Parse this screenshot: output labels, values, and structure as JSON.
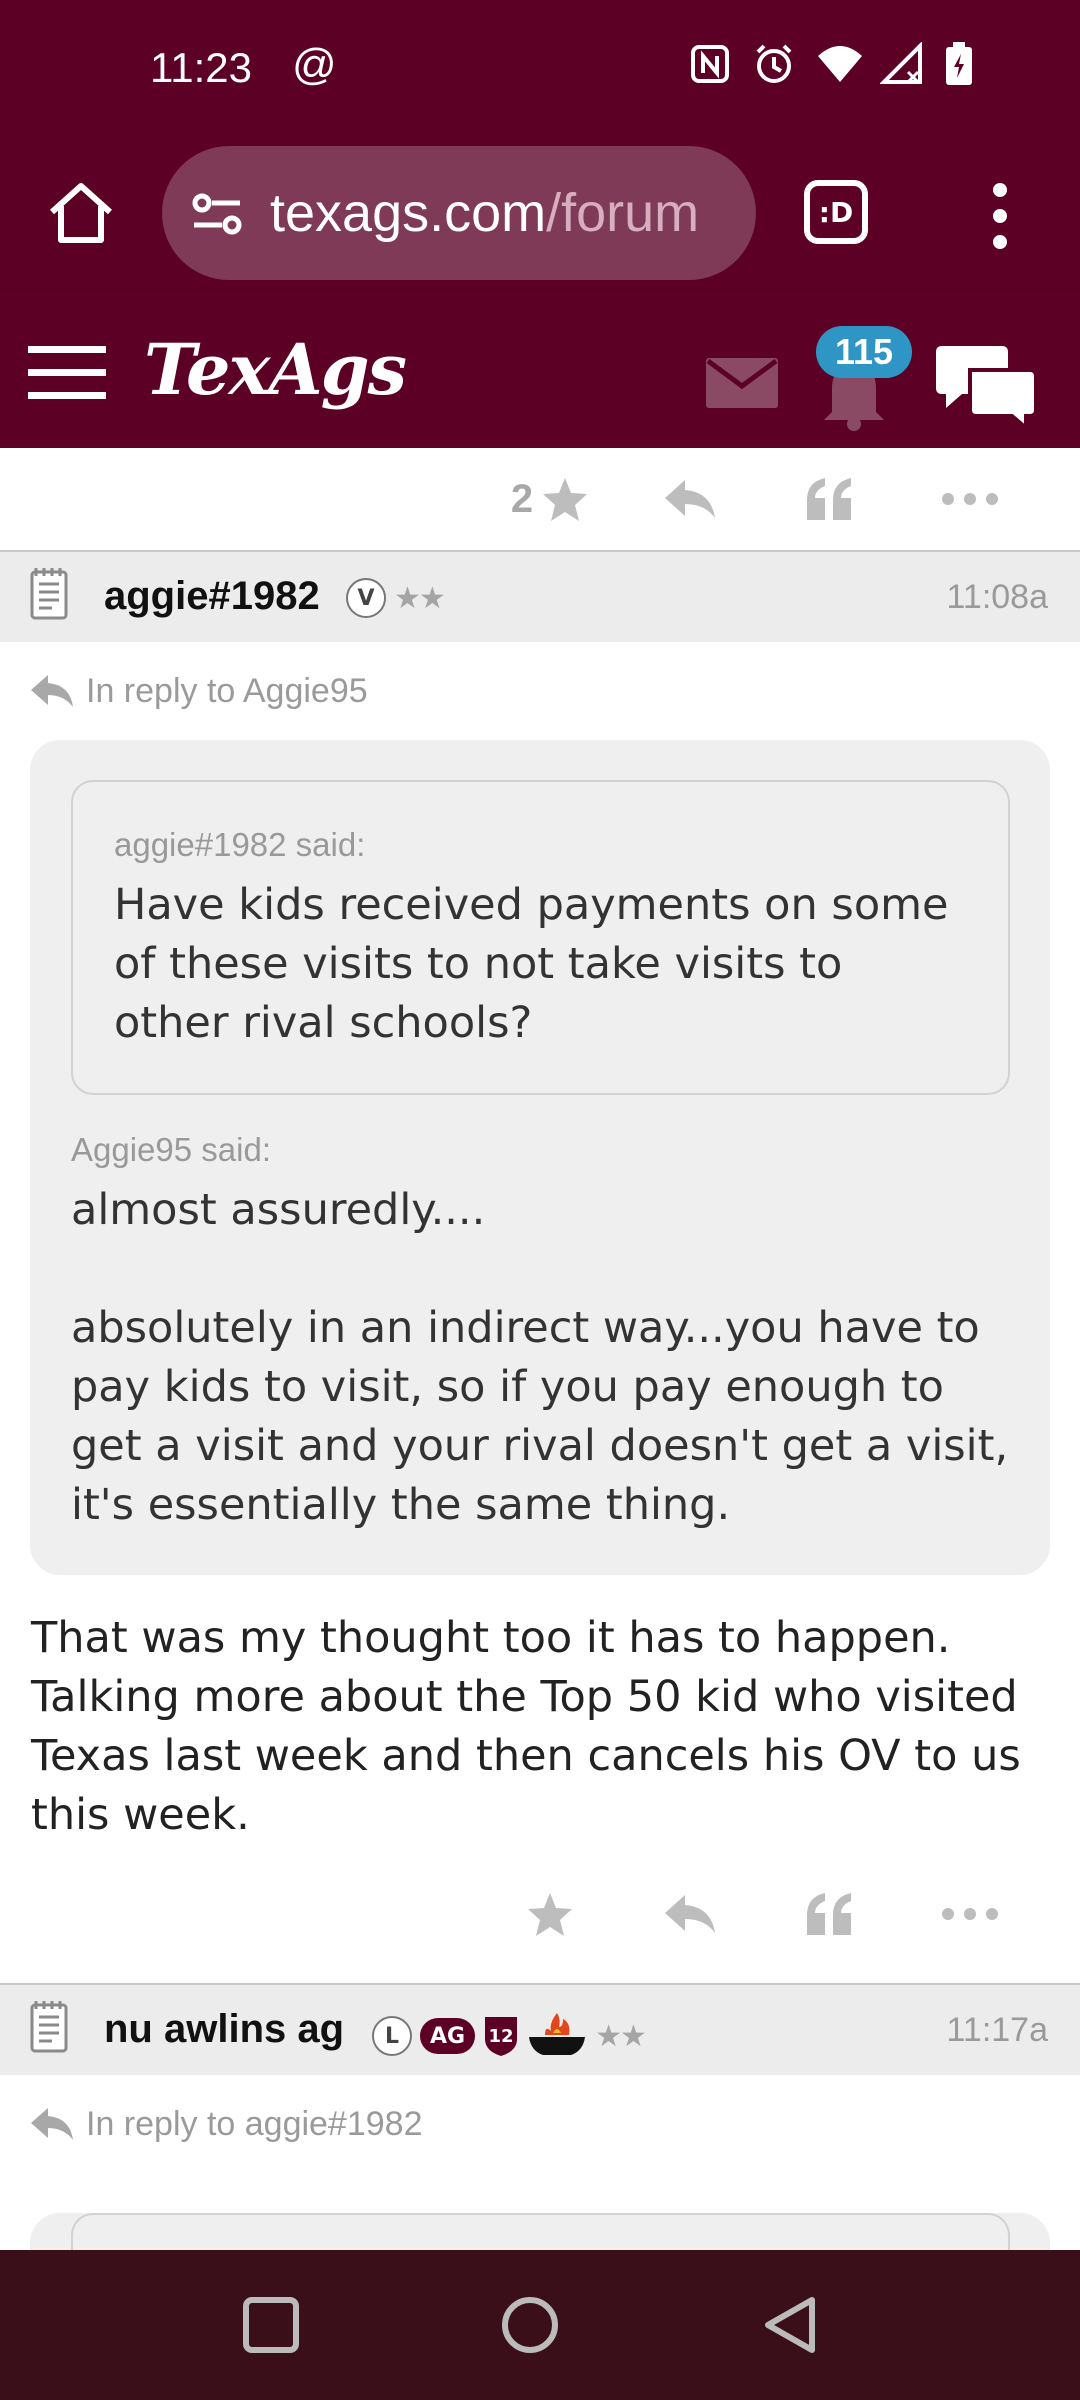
{
  "status_bar": {
    "time": "11:23",
    "at_symbol": "@",
    "icons": [
      "nfc-icon",
      "alarm-icon",
      "wifi-icon",
      "signal-icon",
      "battery-icon"
    ]
  },
  "browser": {
    "url_host": "texags.com",
    "url_path": "/forum",
    "tabs_label": ":D"
  },
  "site": {
    "logo": "TexAgs",
    "notification_count": "115",
    "theme_color": "#5c0025",
    "badge_color": "#2f95c4"
  },
  "prev_post": {
    "star_count": "2"
  },
  "post": {
    "username": "aggie#1982",
    "badge_v": "V",
    "stars": "★★",
    "time": "11:08a",
    "reply_to": "In reply to Aggie95",
    "nested_quote_said": "aggie#1982 said:",
    "nested_quote_text": "Have kids received payments on some of these visits to not take visits to other rival schools?",
    "quote_said": "Aggie95 said:",
    "quote_text": "almost assuredly....\n\nabsolutely in an indirect way...you have to pay kids to visit, so if you pay enough to get a visit and your rival doesn't get a visit, it's essentially the same thing.",
    "body": "That was my thought too it has to happen. Talking more about the Top 50 kid who visited Texas last week and then cancels his OV to us this week."
  },
  "next_post": {
    "username": "nu awlins ag",
    "badge_l": "L",
    "badge_ag": "AG",
    "badge_12": "12",
    "stars": "★★",
    "time": "11:17a",
    "reply_to": "In reply to aggie#1982"
  }
}
